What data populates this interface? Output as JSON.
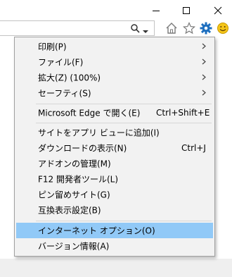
{
  "window_controls": {
    "minimize": "minimize-icon",
    "maximize": "maximize-icon",
    "close": "close-icon"
  },
  "toolbar": {
    "icons": [
      "search-icon",
      "chevron-down-icon",
      "home-icon",
      "star-icon",
      "gear-icon",
      "smiley-icon"
    ],
    "colors": {
      "gear": "#1e6fbf",
      "smiley": "#f5c518"
    }
  },
  "menu": {
    "items": [
      {
        "label": "印刷(P)",
        "submenu": true
      },
      {
        "label": "ファイル(F)",
        "submenu": true
      },
      {
        "label": "拡大(Z) (100%)",
        "submenu": true
      },
      {
        "label": "セーフティ(S)",
        "submenu": true
      },
      {
        "label": "Microsoft Edge で開く(E)",
        "shortcut": "Ctrl+Shift+E"
      },
      {
        "label": "サイトをアプリ ビューに追加(I)"
      },
      {
        "label": "ダウンロードの表示(N)",
        "shortcut": "Ctrl+J"
      },
      {
        "label": "アドオンの管理(M)"
      },
      {
        "label": "F12 開発者ツール(L)"
      },
      {
        "label": "ピン留めサイト(G)"
      },
      {
        "label": "互換表示設定(B)"
      },
      {
        "label": "インターネット オプション(O)",
        "highlighted": true
      },
      {
        "label": "バージョン情報(A)"
      }
    ],
    "highlight_color": "#91c9f7"
  }
}
